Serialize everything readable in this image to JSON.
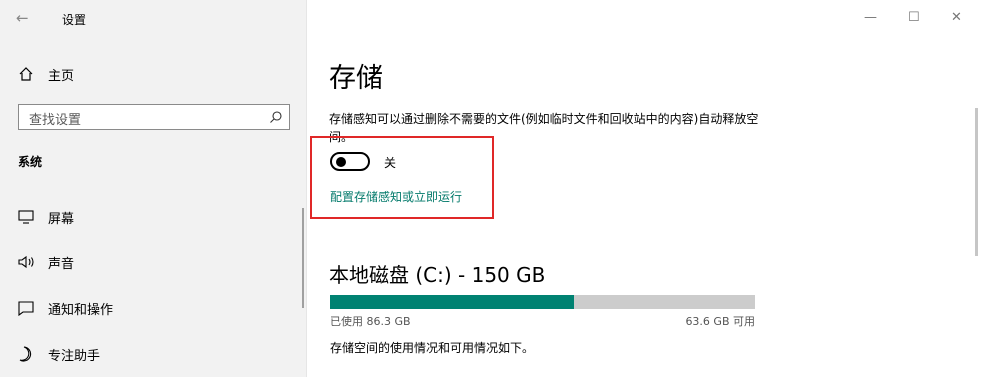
{
  "window": {
    "title": "设置",
    "minimize": "—",
    "maximize": "☐",
    "close": "✕",
    "back": "←"
  },
  "sidebar": {
    "home_label": "主页",
    "search_placeholder": "查找设置",
    "section_title": "系统",
    "items": [
      {
        "label": "屏幕",
        "icon": "monitor-icon"
      },
      {
        "label": "声音",
        "icon": "speaker-icon"
      },
      {
        "label": "通知和操作",
        "icon": "notification-icon"
      },
      {
        "label": "专注助手",
        "icon": "moon-icon"
      }
    ]
  },
  "main": {
    "title": "存储",
    "description": "存储感知可以通过删除不需要的文件(例如临时文件和回收站中的内容)自动释放空间。",
    "storage_sense": {
      "state": "关",
      "on": false
    },
    "configure_link": "配置存储感知或立即运行",
    "disk": {
      "title": "本地磁盘 (C:) - 150 GB",
      "used_label": "已使用 86.3 GB",
      "free_label": "63.6 GB 可用",
      "used_fraction": 0.575,
      "note": "存储空间的使用情况和可用情况如下。"
    }
  },
  "colors": {
    "accent": "#008272",
    "link": "#037a6b",
    "highlight": "#e02828"
  }
}
